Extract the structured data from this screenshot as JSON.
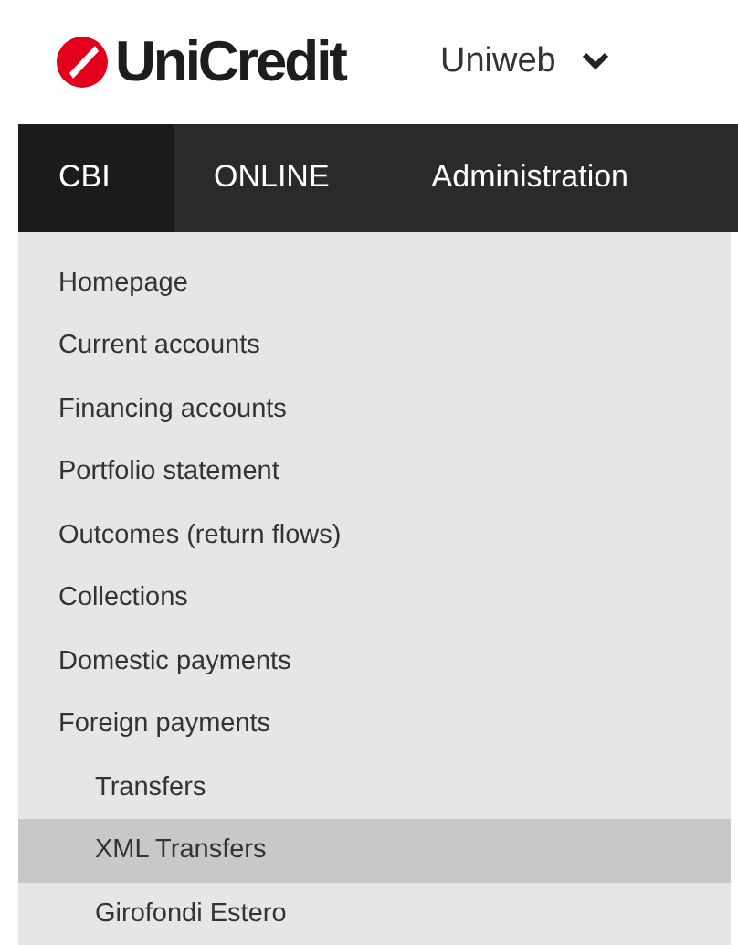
{
  "header": {
    "logo_text": "UniCredit",
    "app_selector": {
      "label": "Uniweb"
    }
  },
  "tabs": [
    {
      "label": "CBI",
      "selected": true
    },
    {
      "label": "ONLINE",
      "selected": false
    },
    {
      "label": "Administration",
      "selected": false
    }
  ],
  "menu": [
    {
      "label": "Homepage",
      "selected": false
    },
    {
      "label": "Current accounts",
      "selected": false
    },
    {
      "label": "Financing accounts",
      "selected": false
    },
    {
      "label": "Portfolio statement",
      "selected": false
    },
    {
      "label": "Outcomes (return flows)",
      "selected": false
    },
    {
      "label": "Collections",
      "selected": false
    },
    {
      "label": "Domestic payments",
      "selected": false
    },
    {
      "label": "Foreign payments",
      "selected": false,
      "children": [
        {
          "label": "Transfers",
          "selected": false
        },
        {
          "label": "XML Transfers",
          "selected": true
        },
        {
          "label": "Girofondi Estero",
          "selected": false
        }
      ]
    }
  ]
}
